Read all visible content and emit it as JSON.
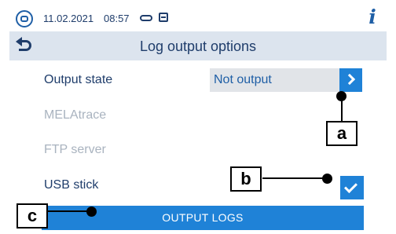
{
  "status_bar": {
    "date": "11.02.2021",
    "time": "08:57",
    "icons": [
      "device-logo-icon",
      "usb-icon",
      "printer-icon"
    ],
    "info_button_label": "i"
  },
  "header": {
    "back_icon": "back-arrow-icon",
    "title": "Log output options"
  },
  "options": {
    "output_state": {
      "label": "Output state",
      "value": "Not output",
      "next_icon": "chevron-right-icon"
    },
    "melatrace": {
      "label": "MELAtrace",
      "enabled": false
    },
    "ftp_server": {
      "label": "FTP server",
      "enabled": false
    },
    "usb_stick": {
      "label": "USB stick",
      "checked": true,
      "check_icon": "checkmark-icon"
    }
  },
  "action": {
    "output_logs_label": "OUTPUT LOGS"
  },
  "callouts": {
    "a": "a",
    "b": "b",
    "c": "c"
  },
  "colors": {
    "accent": "#1f82d7",
    "text": "#1f3d6b",
    "disabled_text": "#a9b3bf",
    "header_bg": "#dce4ee",
    "select_bg": "#e1e4e8"
  }
}
